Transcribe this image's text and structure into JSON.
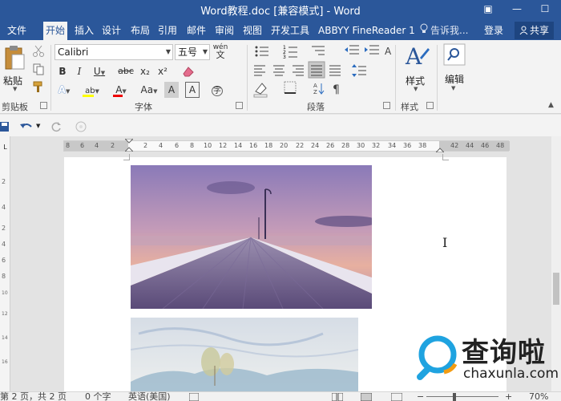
{
  "window": {
    "title": "Word教程.doc [兼容模式] - Word",
    "ribbon_options_icon": "▣",
    "minimize_icon": "—",
    "maximize_icon": "☐"
  },
  "tabs": {
    "file": "文件",
    "home": "开始",
    "insert": "插入",
    "design": "设计",
    "layout": "布局",
    "references": "引用",
    "mailings": "邮件",
    "review": "审阅",
    "view": "视图",
    "developer": "开发工具",
    "abbyy": "ABBYY FineReader 1",
    "tell_me": "告诉我...",
    "login": "登录",
    "share": "共享"
  },
  "ribbon": {
    "clipboard": {
      "paste": "粘贴",
      "label": "剪贴板"
    },
    "font": {
      "font_name": "Calibri",
      "font_size": "五号",
      "phonetic": "wén",
      "grow": "A",
      "shrink": "A",
      "case": "Aa",
      "clear": "A",
      "bold": "B",
      "italic": "I",
      "underline": "U",
      "strikethrough": "abc",
      "subscript": "x₂",
      "superscript": "x²",
      "text_effects": "A",
      "highlight": "ab",
      "font_color": "A",
      "char_shading": "A",
      "enclose": "字",
      "label": "字体"
    },
    "paragraph": {
      "label": "段落"
    },
    "styles": {
      "styles": "样式",
      "label": "样式"
    },
    "editing": {
      "editing": "编辑"
    }
  },
  "ruler": {
    "numbers": [
      "8",
      "6",
      "4",
      "2",
      "2",
      "4",
      "6",
      "8",
      "10",
      "12",
      "14",
      "16",
      "18",
      "20",
      "22",
      "24",
      "26",
      "28",
      "30",
      "32",
      "34",
      "36",
      "38",
      "42",
      "44",
      "46",
      "48"
    ],
    "vertical_numbers": [
      "2",
      "4",
      "2",
      "4",
      "6",
      "8",
      "10",
      "12",
      "14",
      "16"
    ]
  },
  "logo": {
    "brand": "查询啦",
    "url": "chaxunla.com"
  },
  "status": {
    "page": "第 2 页，共 2 页",
    "words": "0 个字",
    "language": "英语(美国)",
    "zoom": "70%"
  },
  "colors": {
    "brand": "#2b579a",
    "ribbon": "#f3f3f3",
    "logo_blue": "#1fa3e0"
  }
}
